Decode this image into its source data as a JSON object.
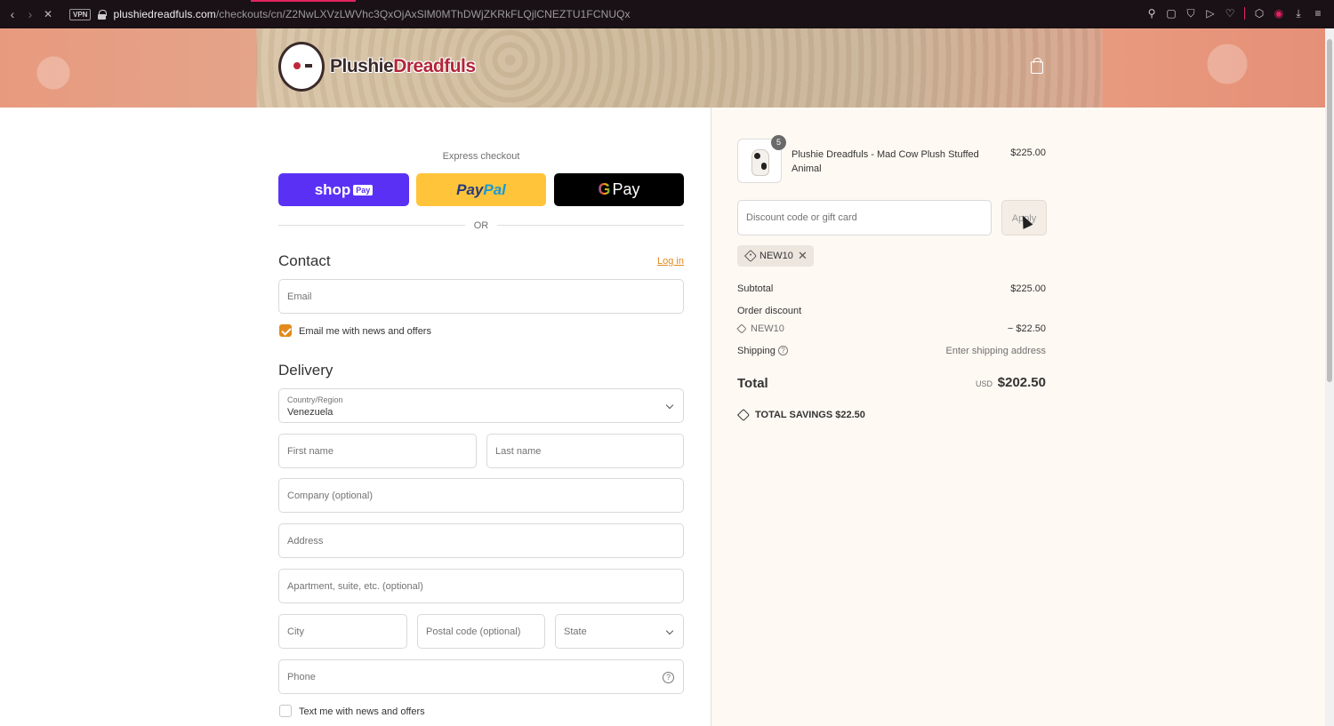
{
  "browser": {
    "url_host": "plushiedreadfuls.com",
    "url_path": "/checkouts/cn/Z2NwLXVzLWVhc3QxOjAxSlM0MThDWjZKRkFLQjlCNEZTU1FCNUQx",
    "vpn_label": "VPN"
  },
  "header": {
    "logo_part1": "Plushie",
    "logo_part2": "Dreadfuls"
  },
  "express": {
    "label": "Express checkout",
    "shop_pay": "shop",
    "shop_pay_tag": "Pay",
    "paypal_1": "Pay",
    "paypal_2": "Pal",
    "gpay_g": "G",
    "gpay_text": "Pay",
    "or": "OR"
  },
  "contact": {
    "heading": "Contact",
    "login": "Log in",
    "email_placeholder": "Email",
    "newsletter_label": "Email me with news and offers"
  },
  "delivery": {
    "heading": "Delivery",
    "country_label": "Country/Region",
    "country_value": "Venezuela",
    "first_name": "First name",
    "last_name": "Last name",
    "company": "Company (optional)",
    "address": "Address",
    "apartment": "Apartment, suite, etc. (optional)",
    "city": "City",
    "postal": "Postal code (optional)",
    "state": "State",
    "phone": "Phone",
    "sms_label": "Text me with news and offers"
  },
  "summary": {
    "product_name": "Plushie Dreadfuls - Mad Cow Plush Stuffed Animal",
    "product_price": "$225.00",
    "quantity": "5",
    "discount_placeholder": "Discount code or gift card",
    "apply": "Apply",
    "applied_code": "NEW10",
    "remove_symbol": "✕",
    "subtotal_label": "Subtotal",
    "subtotal_value": "$225.00",
    "order_discount_label": "Order discount",
    "discount_code": "NEW10",
    "discount_value": "− $22.50",
    "shipping_label": "Shipping",
    "shipping_value": "Enter shipping address",
    "total_label": "Total",
    "currency": "USD",
    "total_value": "$202.50",
    "savings_label": "TOTAL SAVINGS",
    "savings_value": "$22.50"
  },
  "colors": {
    "accent": "#e28a1d",
    "shop_pay": "#5a31f4",
    "paypal": "#ffc439",
    "summary_bg": "#fff9f3"
  }
}
